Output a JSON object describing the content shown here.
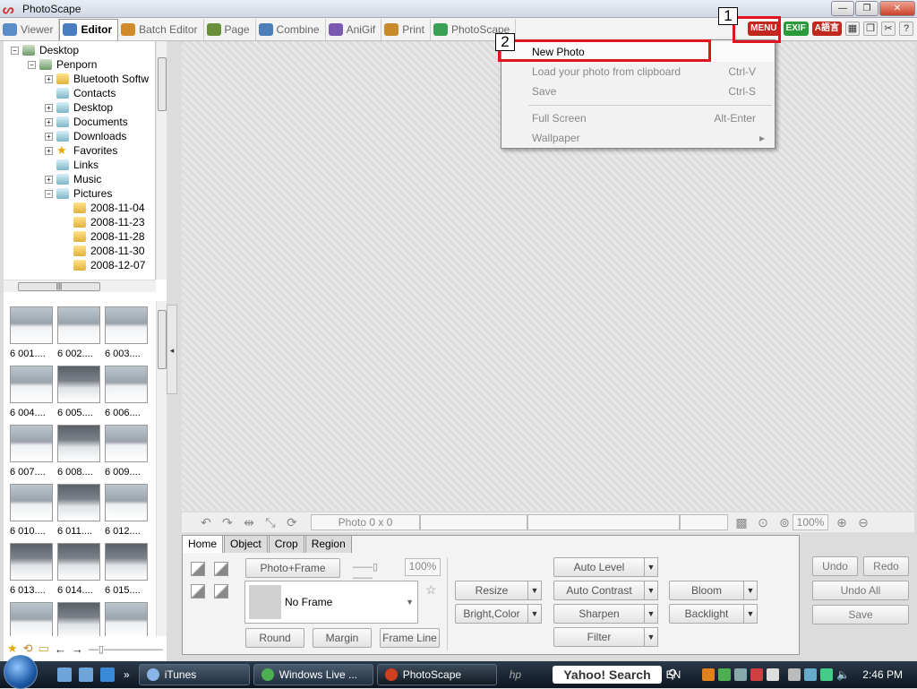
{
  "window": {
    "title": "PhotoScape",
    "minimize": "—",
    "maximize": "❐",
    "close": "✕"
  },
  "tabs": [
    {
      "label": "Viewer",
      "color": "#5b8dc9"
    },
    {
      "label": "Editor",
      "color": "#4a7ec0"
    },
    {
      "label": "Batch Editor",
      "color": "#d08a2a"
    },
    {
      "label": "Page",
      "color": "#6a8f3a"
    },
    {
      "label": "Combine",
      "color": "#4c7fb8"
    },
    {
      "label": "AniGif",
      "color": "#7a5ab0"
    },
    {
      "label": "Print",
      "color": "#c88a2a"
    },
    {
      "label": "PhotoScape",
      "color": "#3aa055"
    }
  ],
  "toolbar": {
    "menu_label": "MENU",
    "exif_label": "EXIF",
    "lang_label": "A語言",
    "menu_color": "#c0281e",
    "exif_color": "#2b9a3a",
    "lang_color": "#c0281e"
  },
  "tree": [
    {
      "label": "Desktop",
      "level": 0,
      "exp": "−",
      "icon": "pc"
    },
    {
      "label": "Penporn",
      "level": 1,
      "exp": "−",
      "icon": "pc"
    },
    {
      "label": "Bluetooth Softw",
      "level": 2,
      "exp": "+",
      "icon": "folder"
    },
    {
      "label": "Contacts",
      "level": 2,
      "exp": "",
      "icon": "lib"
    },
    {
      "label": "Desktop",
      "level": 2,
      "exp": "+",
      "icon": "lib"
    },
    {
      "label": "Documents",
      "level": 2,
      "exp": "+",
      "icon": "lib"
    },
    {
      "label": "Downloads",
      "level": 2,
      "exp": "+",
      "icon": "lib"
    },
    {
      "label": "Favorites",
      "level": 2,
      "exp": "+",
      "icon": "star"
    },
    {
      "label": "Links",
      "level": 2,
      "exp": "",
      "icon": "lib"
    },
    {
      "label": "Music",
      "level": 2,
      "exp": "+",
      "icon": "lib"
    },
    {
      "label": "Pictures",
      "level": 2,
      "exp": "−",
      "icon": "lib"
    },
    {
      "label": "2008-11-04",
      "level": 3,
      "exp": "",
      "icon": "folder"
    },
    {
      "label": "2008-11-23",
      "level": 3,
      "exp": "",
      "icon": "folder"
    },
    {
      "label": "2008-11-28",
      "level": 3,
      "exp": "",
      "icon": "folder"
    },
    {
      "label": "2008-11-30",
      "level": 3,
      "exp": "",
      "icon": "folder"
    },
    {
      "label": "2008-12-07",
      "level": 3,
      "exp": "",
      "icon": "folder"
    }
  ],
  "thumbnails": [
    {
      "caption": "6 001....",
      "dark": false
    },
    {
      "caption": "6 002....",
      "dark": false
    },
    {
      "caption": "6 003....",
      "dark": false
    },
    {
      "caption": "6 004....",
      "dark": false
    },
    {
      "caption": "6 005....",
      "dark": true
    },
    {
      "caption": "6 006....",
      "dark": false
    },
    {
      "caption": "6 007....",
      "dark": false
    },
    {
      "caption": "6 008....",
      "dark": true
    },
    {
      "caption": "6 009....",
      "dark": false
    },
    {
      "caption": "6 010....",
      "dark": false
    },
    {
      "caption": "6 011....",
      "dark": true
    },
    {
      "caption": "6 012....",
      "dark": false
    },
    {
      "caption": "6 013....",
      "dark": true
    },
    {
      "caption": "6 014....",
      "dark": true
    },
    {
      "caption": "6 015....",
      "dark": true
    },
    {
      "caption": "",
      "dark": false
    },
    {
      "caption": "",
      "dark": true
    },
    {
      "caption": "",
      "dark": false
    }
  ],
  "status": {
    "photo_size": "Photo 0 x 0",
    "zoom": "100%"
  },
  "edit_tabs": [
    "Home",
    "Object",
    "Crop",
    "Region"
  ],
  "edit": {
    "photo_frame": "Photo+Frame",
    "frame_percent": "100%",
    "frame_name": "No Frame",
    "round": "Round",
    "margin": "Margin",
    "frame_line": "Frame Line",
    "resize": "Resize",
    "bright_color": "Bright,Color",
    "auto_level": "Auto Level",
    "auto_contrast": "Auto Contrast",
    "sharpen": "Sharpen",
    "filter": "Filter",
    "bloom": "Bloom",
    "backlight": "Backlight",
    "undo": "Undo",
    "redo": "Redo",
    "undo_all": "Undo All",
    "save": "Save"
  },
  "menu": {
    "items": [
      {
        "label": "New Photo",
        "shortcut": ""
      },
      {
        "label": "Load your photo from clipboard",
        "shortcut": "Ctrl-V"
      },
      {
        "label": "Save",
        "shortcut": "Ctrl-S"
      },
      {
        "label": "Full Screen",
        "shortcut": "Alt-Enter"
      },
      {
        "label": "Wallpaper",
        "shortcut": "▸"
      }
    ]
  },
  "annotations": {
    "step1": "1",
    "step2": "2",
    "highlight_color": "#e0141e"
  },
  "taskbar": {
    "tasks": [
      {
        "label": "iTunes",
        "color": "#8ab4e8"
      },
      {
        "label": "Windows Live ...",
        "color": "#4caf50"
      },
      {
        "label": "PhotoScape",
        "color": "#d04020"
      }
    ],
    "search": "Yahoo! Search",
    "lang": "EN",
    "time": "2:46 PM"
  }
}
